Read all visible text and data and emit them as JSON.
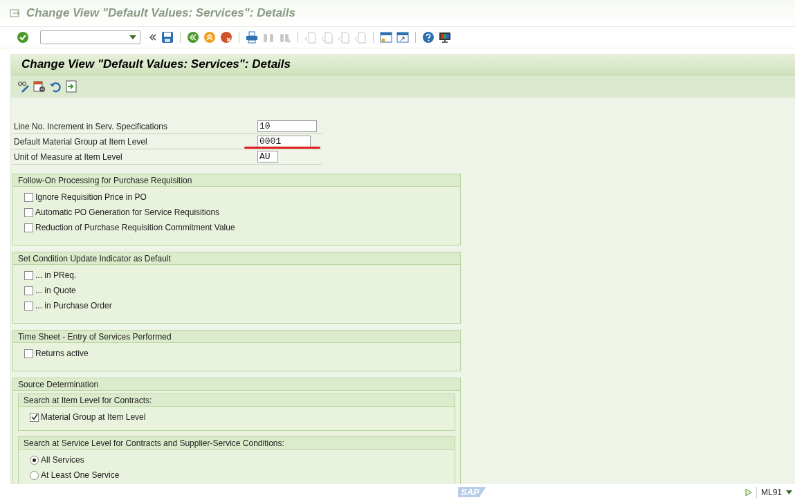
{
  "window": {
    "title": "Change View \"Default Values: Services\": Details"
  },
  "screen_header": {
    "title": "Change View \"Default Values: Services\": Details"
  },
  "fields": [
    {
      "label": "Line No. Increment in Serv. Specifications",
      "value": "10"
    },
    {
      "label": "Default Material Group at Item Level",
      "value": "0001"
    },
    {
      "label": "Unit of Measure at Item Level",
      "value": "AU"
    }
  ],
  "groups": [
    {
      "title": "Follow-On Processing for Purchase Requisition",
      "items": [
        {
          "kind": "checkbox",
          "label": "Ignore Requisition Price in PO",
          "checked": false
        },
        {
          "kind": "checkbox",
          "label": "Automatic PO Generation for Service Requisitions",
          "checked": false
        },
        {
          "kind": "checkbox",
          "label": "Reduction of Purchase Requisition Commitment Value",
          "checked": false
        }
      ]
    },
    {
      "title": "Set Condition Update Indicator as Default",
      "items": [
        {
          "kind": "checkbox",
          "label": "... in PReq.",
          "checked": false
        },
        {
          "kind": "checkbox",
          "label": "... in Quote",
          "checked": false
        },
        {
          "kind": "checkbox",
          "label": "... in Purchase Order",
          "checked": false
        }
      ]
    },
    {
      "title": "Time Sheet - Entry of Services Performed",
      "items": [
        {
          "kind": "checkbox",
          "label": "Returns active",
          "checked": false
        }
      ]
    },
    {
      "title": "Source Determination",
      "children": [
        {
          "title": "Search at Item Level for Contracts:",
          "items": [
            {
              "kind": "checkbox",
              "label": "Material Group at Item Level",
              "checked": true
            }
          ]
        },
        {
          "title": "Search at Service Level for Contracts and Supplier-Service Conditions:",
          "items": [
            {
              "kind": "radio",
              "label": "All Services",
              "selected": true
            },
            {
              "kind": "radio",
              "label": "At Least One Service",
              "selected": false
            }
          ]
        }
      ]
    }
  ],
  "status_bar": {
    "logo": "SAP",
    "transaction": "ML91"
  }
}
